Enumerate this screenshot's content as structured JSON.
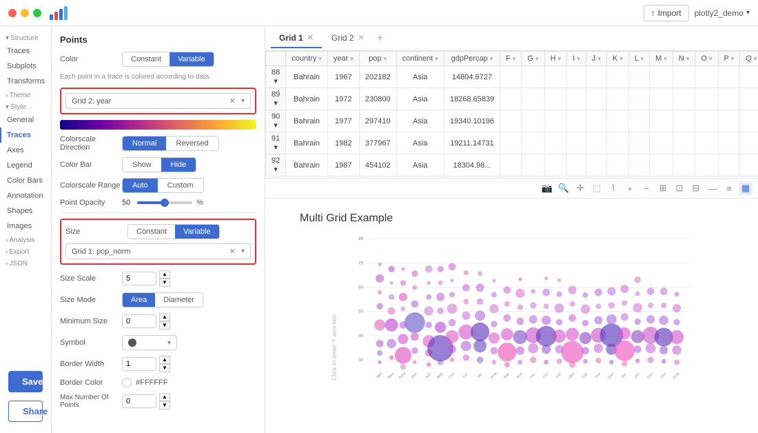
{
  "titlebar": {
    "import_label": "Import",
    "demo_label": "plotly2_demo",
    "chevron": "▾"
  },
  "sidebar": {
    "structure_label": "Structure",
    "style_label": "Style",
    "items": [
      {
        "label": "Traces",
        "id": "traces",
        "active": false,
        "group": "structure"
      },
      {
        "label": "Subplots",
        "id": "subplots",
        "active": false,
        "group": "structure"
      },
      {
        "label": "Transforms",
        "id": "transforms",
        "active": false,
        "group": "structure"
      },
      {
        "label": "Theme",
        "id": "theme",
        "active": false,
        "group": "theme"
      },
      {
        "label": "General",
        "id": "general",
        "active": false,
        "group": "style"
      },
      {
        "label": "Traces",
        "id": "traces-style",
        "active": true,
        "group": "style"
      },
      {
        "label": "Axes",
        "id": "axes",
        "active": false,
        "group": "style"
      },
      {
        "label": "Legend",
        "id": "legend",
        "active": false,
        "group": "style"
      },
      {
        "label": "Color Bars",
        "id": "colorbars",
        "active": false,
        "group": "style"
      },
      {
        "label": "Annotation",
        "id": "annotation",
        "active": false,
        "group": "style"
      },
      {
        "label": "Shapes",
        "id": "shapes",
        "active": false,
        "group": "style"
      },
      {
        "label": "Images",
        "id": "images",
        "active": false,
        "group": "style"
      },
      {
        "label": "Analysis",
        "id": "analysis",
        "active": false,
        "group": "analysis"
      },
      {
        "label": "Export",
        "id": "export",
        "active": false,
        "group": "export"
      },
      {
        "label": "JSON",
        "id": "json",
        "active": false,
        "group": "json"
      }
    ]
  },
  "panel": {
    "title": "Points",
    "color_label": "Color",
    "constant_btn": "Constant",
    "variable_btn": "Variable",
    "info_text": "Each point in a trace is colored according to data.",
    "color_dropdown": "Grid 2: year",
    "colorscale_direction_label": "Colorscale Direction",
    "normal_btn": "Normal",
    "reversed_btn": "Reversed",
    "color_bar_label": "Color Bar",
    "show_btn": "Show",
    "hide_btn": "Hide",
    "colorscale_range_label": "Colorscale Range",
    "auto_btn": "Auto",
    "custom_btn": "Custom",
    "point_opacity_label": "Point Opacity",
    "opacity_value": "50",
    "opacity_percent": "%",
    "size_label": "Size",
    "size_constant_btn": "Constant",
    "size_variable_btn": "Variable",
    "size_dropdown": "Grid 1: pop_norm",
    "size_scale_label": "Size Scale",
    "size_scale_value": "5",
    "size_mode_label": "Size Mode",
    "area_btn": "Area",
    "diameter_btn": "Diameter",
    "min_size_label": "Minimum Size",
    "min_size_value": "0",
    "symbol_label": "Symbol",
    "border_width_label": "Border Width",
    "border_width_value": "1",
    "border_color_label": "Border Color",
    "border_color_hex": "#FFFFFF",
    "max_number_label": "Max Number Of Points",
    "max_number_value": "0",
    "save_btn": "Save",
    "share_btn": "Share"
  },
  "grid_tabs": [
    {
      "label": "Grid 1",
      "active": true,
      "closeable": true
    },
    {
      "label": "Grid 2",
      "active": false,
      "closeable": true
    }
  ],
  "table": {
    "columns": [
      "",
      "country",
      "year▾",
      "pop",
      "continent",
      "gdpPercap▾",
      "F",
      "G",
      "H",
      "I",
      "J",
      "K",
      "L",
      "M",
      "N",
      "O",
      "P",
      "Q"
    ],
    "rows": [
      {
        "num": "88",
        "country": "Bahrain",
        "year": "1967",
        "pop": "202182",
        "continent": "Asia",
        "gdpPercap": "14804.6727",
        "extra": ""
      },
      {
        "num": "89",
        "country": "Bahrain",
        "year": "1972",
        "pop": "230800",
        "continent": "Asia",
        "gdpPercap": "18268.65839",
        "extra": ""
      },
      {
        "num": "90",
        "country": "Bahrain",
        "year": "1977",
        "pop": "297410",
        "continent": "Asia",
        "gdpPercap": "19340.10196",
        "extra": ""
      },
      {
        "num": "91",
        "country": "Bahrain",
        "year": "1982",
        "pop": "377967",
        "continent": "Asia",
        "gdpPercap": "19211.14731",
        "extra": ""
      },
      {
        "num": "92",
        "country": "Bahrain",
        "year": "1987",
        "pop": "454102",
        "continent": "Asia",
        "gdpPercap": "18304.98...",
        "extra": ""
      }
    ]
  },
  "chart": {
    "title": "Multi Grid Example",
    "y_axis_label": "Click to enter Y axis title",
    "y_ticks": [
      "80",
      "70",
      "60",
      "50",
      "40",
      "30"
    ],
    "accent_color": "#3d6bce"
  },
  "toolbar_icons": [
    "📷",
    "🔍",
    "✚",
    "⛶",
    "💬",
    "⬚",
    "⬚",
    "✂",
    "📐",
    "—",
    "≡",
    "▦"
  ]
}
